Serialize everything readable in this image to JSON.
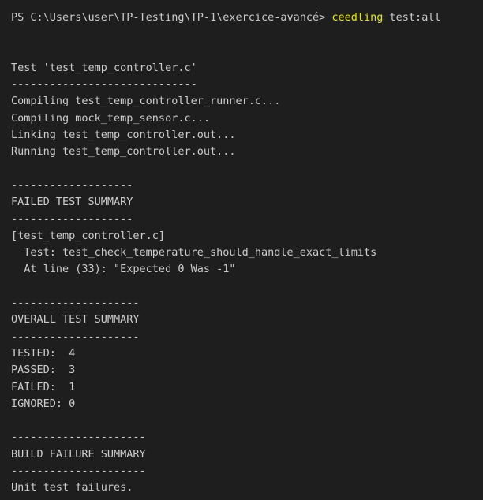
{
  "prompt": {
    "path": "PS C:\\Users\\user\\TP-Testing\\TP-1\\exercice-avancé> ",
    "command": "ceedling",
    "args": " test:all"
  },
  "lines": [
    "",
    "",
    "Test 'test_temp_controller.c'",
    "-----------------------------",
    "Compiling test_temp_controller_runner.c...",
    "Compiling mock_temp_sensor.c...",
    "Linking test_temp_controller.out...",
    "Running test_temp_controller.out...",
    "",
    "-------------------",
    "FAILED TEST SUMMARY",
    "-------------------",
    "[test_temp_controller.c]",
    "  Test: test_check_temperature_should_handle_exact_limits",
    "  At line (33): \"Expected 0 Was -1\"",
    "",
    "--------------------",
    "OVERALL TEST SUMMARY",
    "--------------------",
    "TESTED:  4",
    "PASSED:  3",
    "FAILED:  1",
    "IGNORED: 0",
    "",
    "---------------------",
    "BUILD FAILURE SUMMARY",
    "---------------------",
    "Unit test failures."
  ]
}
